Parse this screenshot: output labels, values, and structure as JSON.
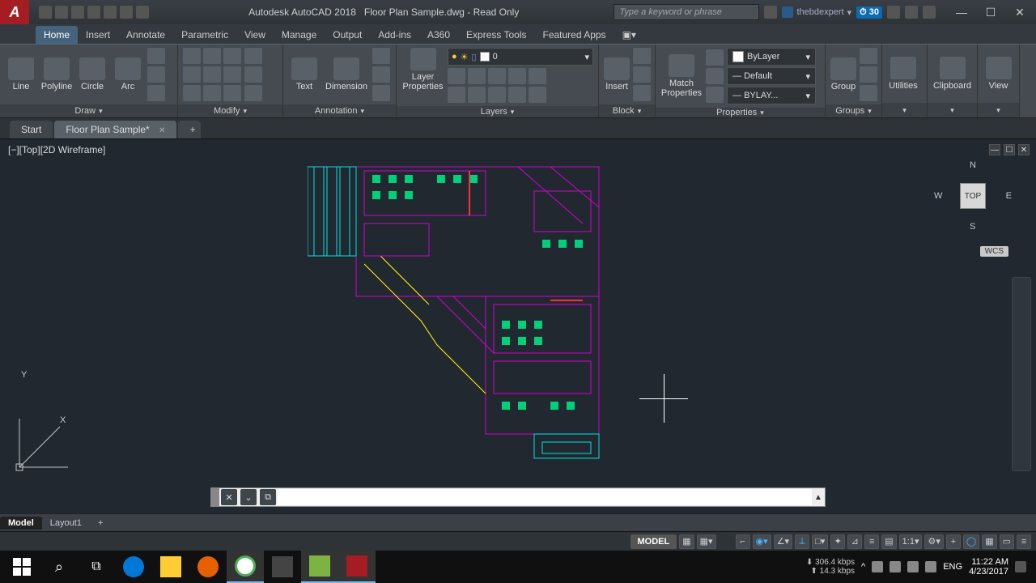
{
  "title": {
    "app": "Autodesk AutoCAD 2018",
    "file": "Floor Plan Sample.dwg - Read Only"
  },
  "search_placeholder": "Type a keyword or phrase",
  "signin": {
    "label": "thebdexpert"
  },
  "trial": "30",
  "menu": {
    "items": [
      "Home",
      "Insert",
      "Annotate",
      "Parametric",
      "View",
      "Manage",
      "Output",
      "Add-ins",
      "A360",
      "Express Tools",
      "Featured Apps"
    ],
    "active": 0
  },
  "ribbon": {
    "draw": {
      "title": "Draw",
      "line": "Line",
      "polyline": "Polyline",
      "circle": "Circle",
      "arc": "Arc"
    },
    "modify": {
      "title": "Modify"
    },
    "annotation": {
      "title": "Annotation",
      "text": "Text",
      "dimension": "Dimension"
    },
    "layers": {
      "title": "Layers",
      "layerprops": "Layer\nProperties",
      "current": "0"
    },
    "block": {
      "title": "Block",
      "insert": "Insert"
    },
    "properties": {
      "title": "Properties",
      "match": "Match\nProperties",
      "color": "ByLayer",
      "lineweight": "Default",
      "linetype": "BYLAY..."
    },
    "groups": {
      "title": "Groups",
      "group": "Group"
    },
    "utilities": {
      "title": "",
      "label": "Utilities"
    },
    "clipboard": {
      "title": "",
      "label": "Clipboard"
    },
    "view": {
      "title": "",
      "label": "View"
    }
  },
  "filetabs": {
    "start": "Start",
    "file": "Floor Plan Sample*",
    "add": "+"
  },
  "viewport": {
    "label": "[−][Top][2D Wireframe]"
  },
  "viewcube": {
    "top": "TOP",
    "n": "N",
    "s": "S",
    "e": "E",
    "w": "W",
    "wcs": "WCS"
  },
  "ucs": {
    "x": "X",
    "y": "Y"
  },
  "bottom_tabs": {
    "model": "Model",
    "layout1": "Layout1",
    "add": "+"
  },
  "status": {
    "model": "MODEL",
    "scale": "1:1"
  },
  "taskbar": {
    "net_down": "306.4 kbps",
    "net_up": "14.3 kbps",
    "lang": "ENG",
    "time": "11:22 AM",
    "date": "4/23/2017"
  }
}
